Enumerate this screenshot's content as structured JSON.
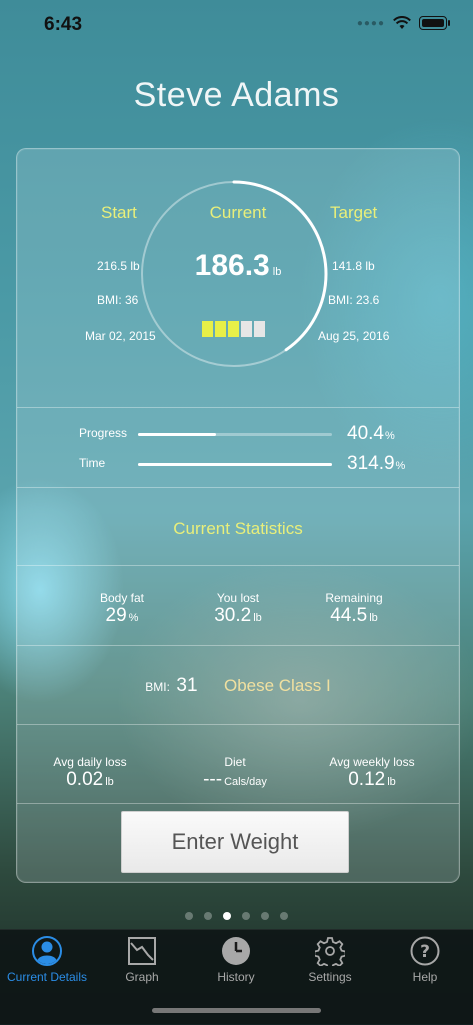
{
  "status_bar": {
    "time": "6:43",
    "signal_icon": "signal-dots-icon",
    "wifi_icon": "wifi-icon",
    "battery_icon": "battery-icon"
  },
  "user": {
    "name": "Steve Adams"
  },
  "summary": {
    "start": {
      "label": "Start",
      "weight": "216.5 lb",
      "bmi": "BMI: 36",
      "date": "Mar 02, 2015"
    },
    "current": {
      "label": "Current",
      "weight": "186.3",
      "unit": "lb",
      "progress_fraction": 0.404,
      "level_segments_filled": 3,
      "level_segments_total": 5
    },
    "target": {
      "label": "Target",
      "weight": "141.8 lb",
      "bmi": "BMI: 23.6",
      "date": "Aug 25, 2016"
    }
  },
  "progress": {
    "progress_label": "Progress",
    "progress_value": "40.4",
    "progress_unit": "%",
    "progress_percent": 40.4,
    "time_label": "Time",
    "time_value": "314.9",
    "time_unit": "%",
    "time_percent": 100
  },
  "current_statistics": {
    "title": "Current Statistics",
    "body_fat": {
      "label": "Body fat",
      "value": "29",
      "unit": "%"
    },
    "you_lost": {
      "label": "You lost",
      "value": "30.2",
      "unit": "lb"
    },
    "remaining": {
      "label": "Remaining",
      "value": "44.5",
      "unit": "lb"
    },
    "bmi": {
      "label": "BMI:",
      "value": "31",
      "class": "Obese Class I"
    },
    "avg_daily_loss": {
      "label": "Avg daily loss",
      "value": "0.02",
      "unit": "lb"
    },
    "diet": {
      "label": "Diet",
      "value": "---",
      "unit": "Cals/day"
    },
    "avg_weekly_loss": {
      "label": "Avg weekly loss",
      "value": "0.12",
      "unit": "lb"
    }
  },
  "enter_weight_button": {
    "label": "Enter Weight"
  },
  "page_indicator": {
    "count": 6,
    "active_index": 2
  },
  "tab_bar": {
    "active_color": "#2b8de6",
    "tabs": [
      {
        "label": "Current Details",
        "icon": "person-icon",
        "active": true
      },
      {
        "label": "Graph",
        "icon": "graph-icon",
        "active": false
      },
      {
        "label": "History",
        "icon": "clock-icon",
        "active": false
      },
      {
        "label": "Settings",
        "icon": "gear-icon",
        "active": false
      },
      {
        "label": "Help",
        "icon": "help-icon",
        "active": false
      }
    ]
  },
  "colors": {
    "accent_yellow": "#e9ef7a",
    "bmi_class": "#f0e0a0",
    "segment_filled": "#e8f048",
    "segment_empty": "#e6e6e6"
  }
}
